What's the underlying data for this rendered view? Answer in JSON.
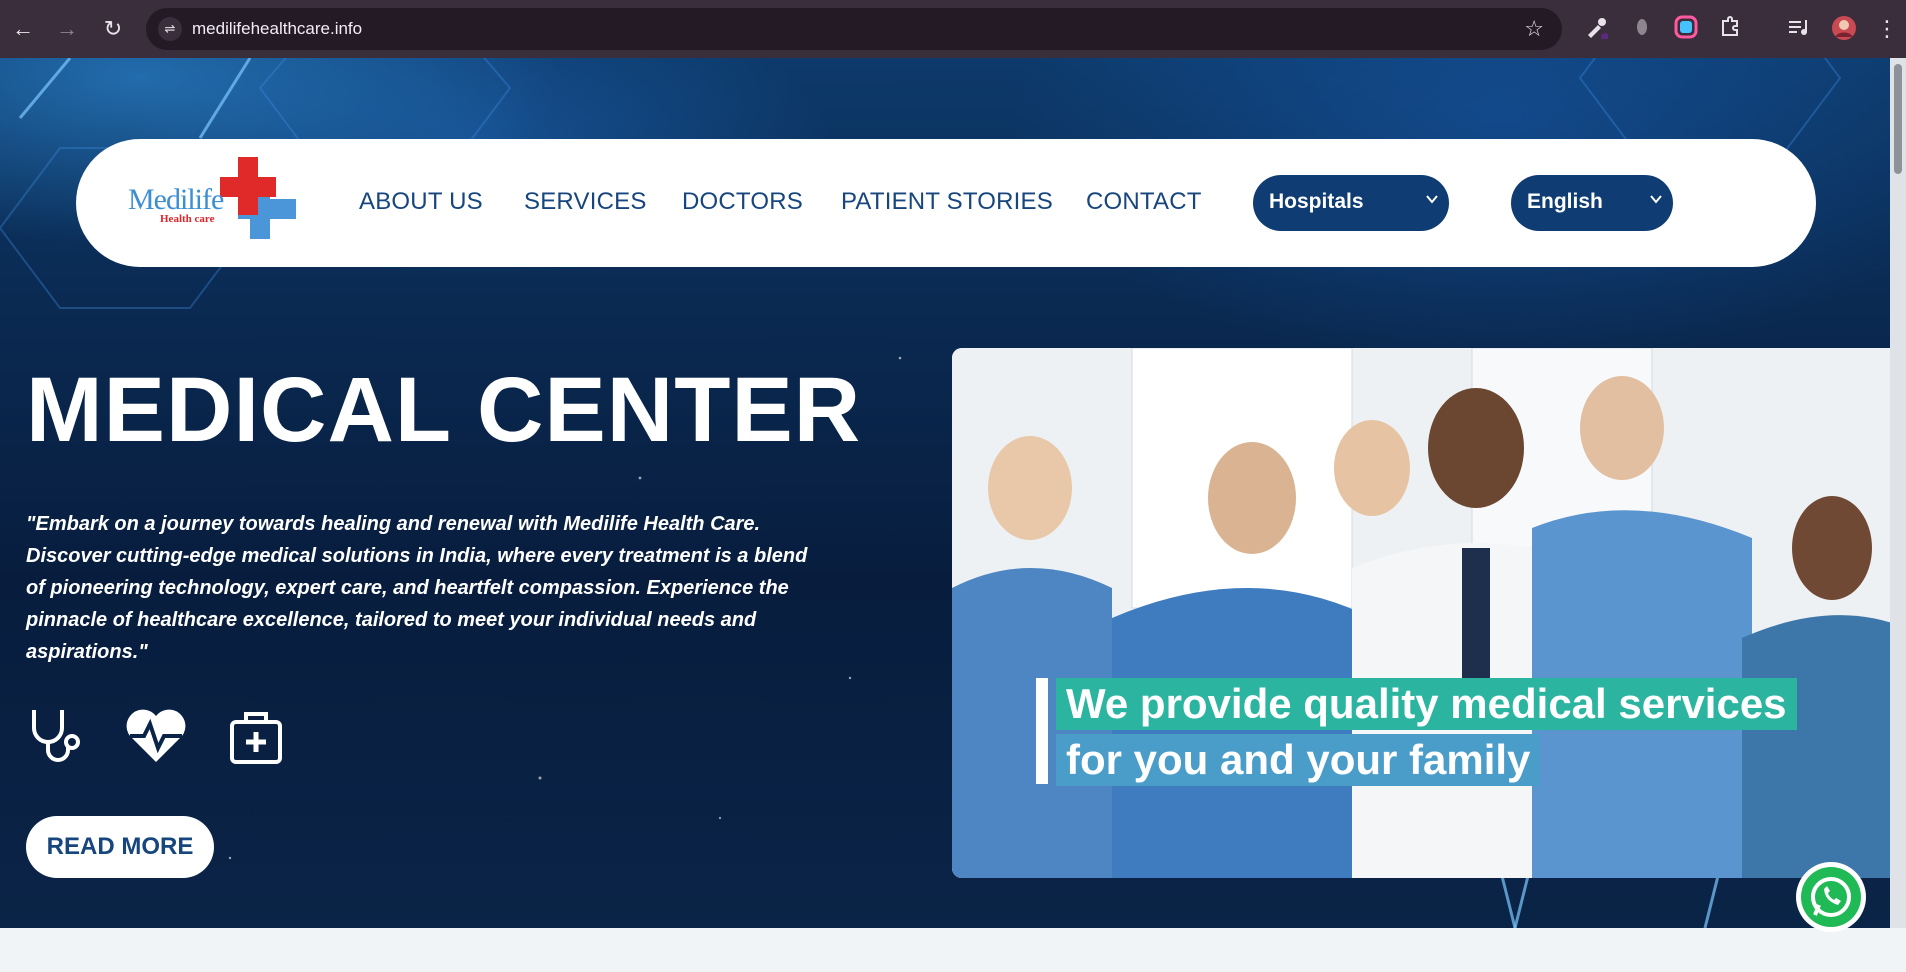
{
  "browser": {
    "url": "medilifehealthcare.info",
    "nav_back": "←",
    "nav_forward": "→",
    "reload": "↻",
    "site_icon": "⇌",
    "star": "☆",
    "menu": "⋮"
  },
  "header": {
    "logo_word": "Medilife",
    "logo_sub": "Health care",
    "nav": {
      "about": "ABOUT US",
      "services": "SERVICES",
      "doctors": "DOCTORS",
      "stories": "PATIENT STORIES",
      "contact": "CONTACT"
    },
    "hospitals_select": "Hospitals",
    "language_select": "English",
    "chevron": "⌄"
  },
  "hero": {
    "title": "MEDICAL CENTER",
    "text": "\"Embark on a journey towards healing and renewal with Medilife Health Care. Discover cutting-edge medical solutions in India, where every treatment is a blend of pioneering technology, expert care, and heartfelt compassion. Experience the pinnacle of healthcare excellence, tailored to meet your individual needs and aspirations.\"",
    "icons": [
      "stethoscope-icon",
      "heart-pulse-icon",
      "first-aid-kit-icon"
    ],
    "cta": "READ MORE"
  },
  "video": {
    "caption_line1": "We provide quality medical services",
    "caption_line2": "for you and your family"
  },
  "colors": {
    "brand_navy": "#17467e",
    "select_bg": "#0f3d73",
    "teal_caption": "#2bb5a0",
    "blue_caption": "#4a9cc9",
    "whatsapp": "#1fb956"
  }
}
